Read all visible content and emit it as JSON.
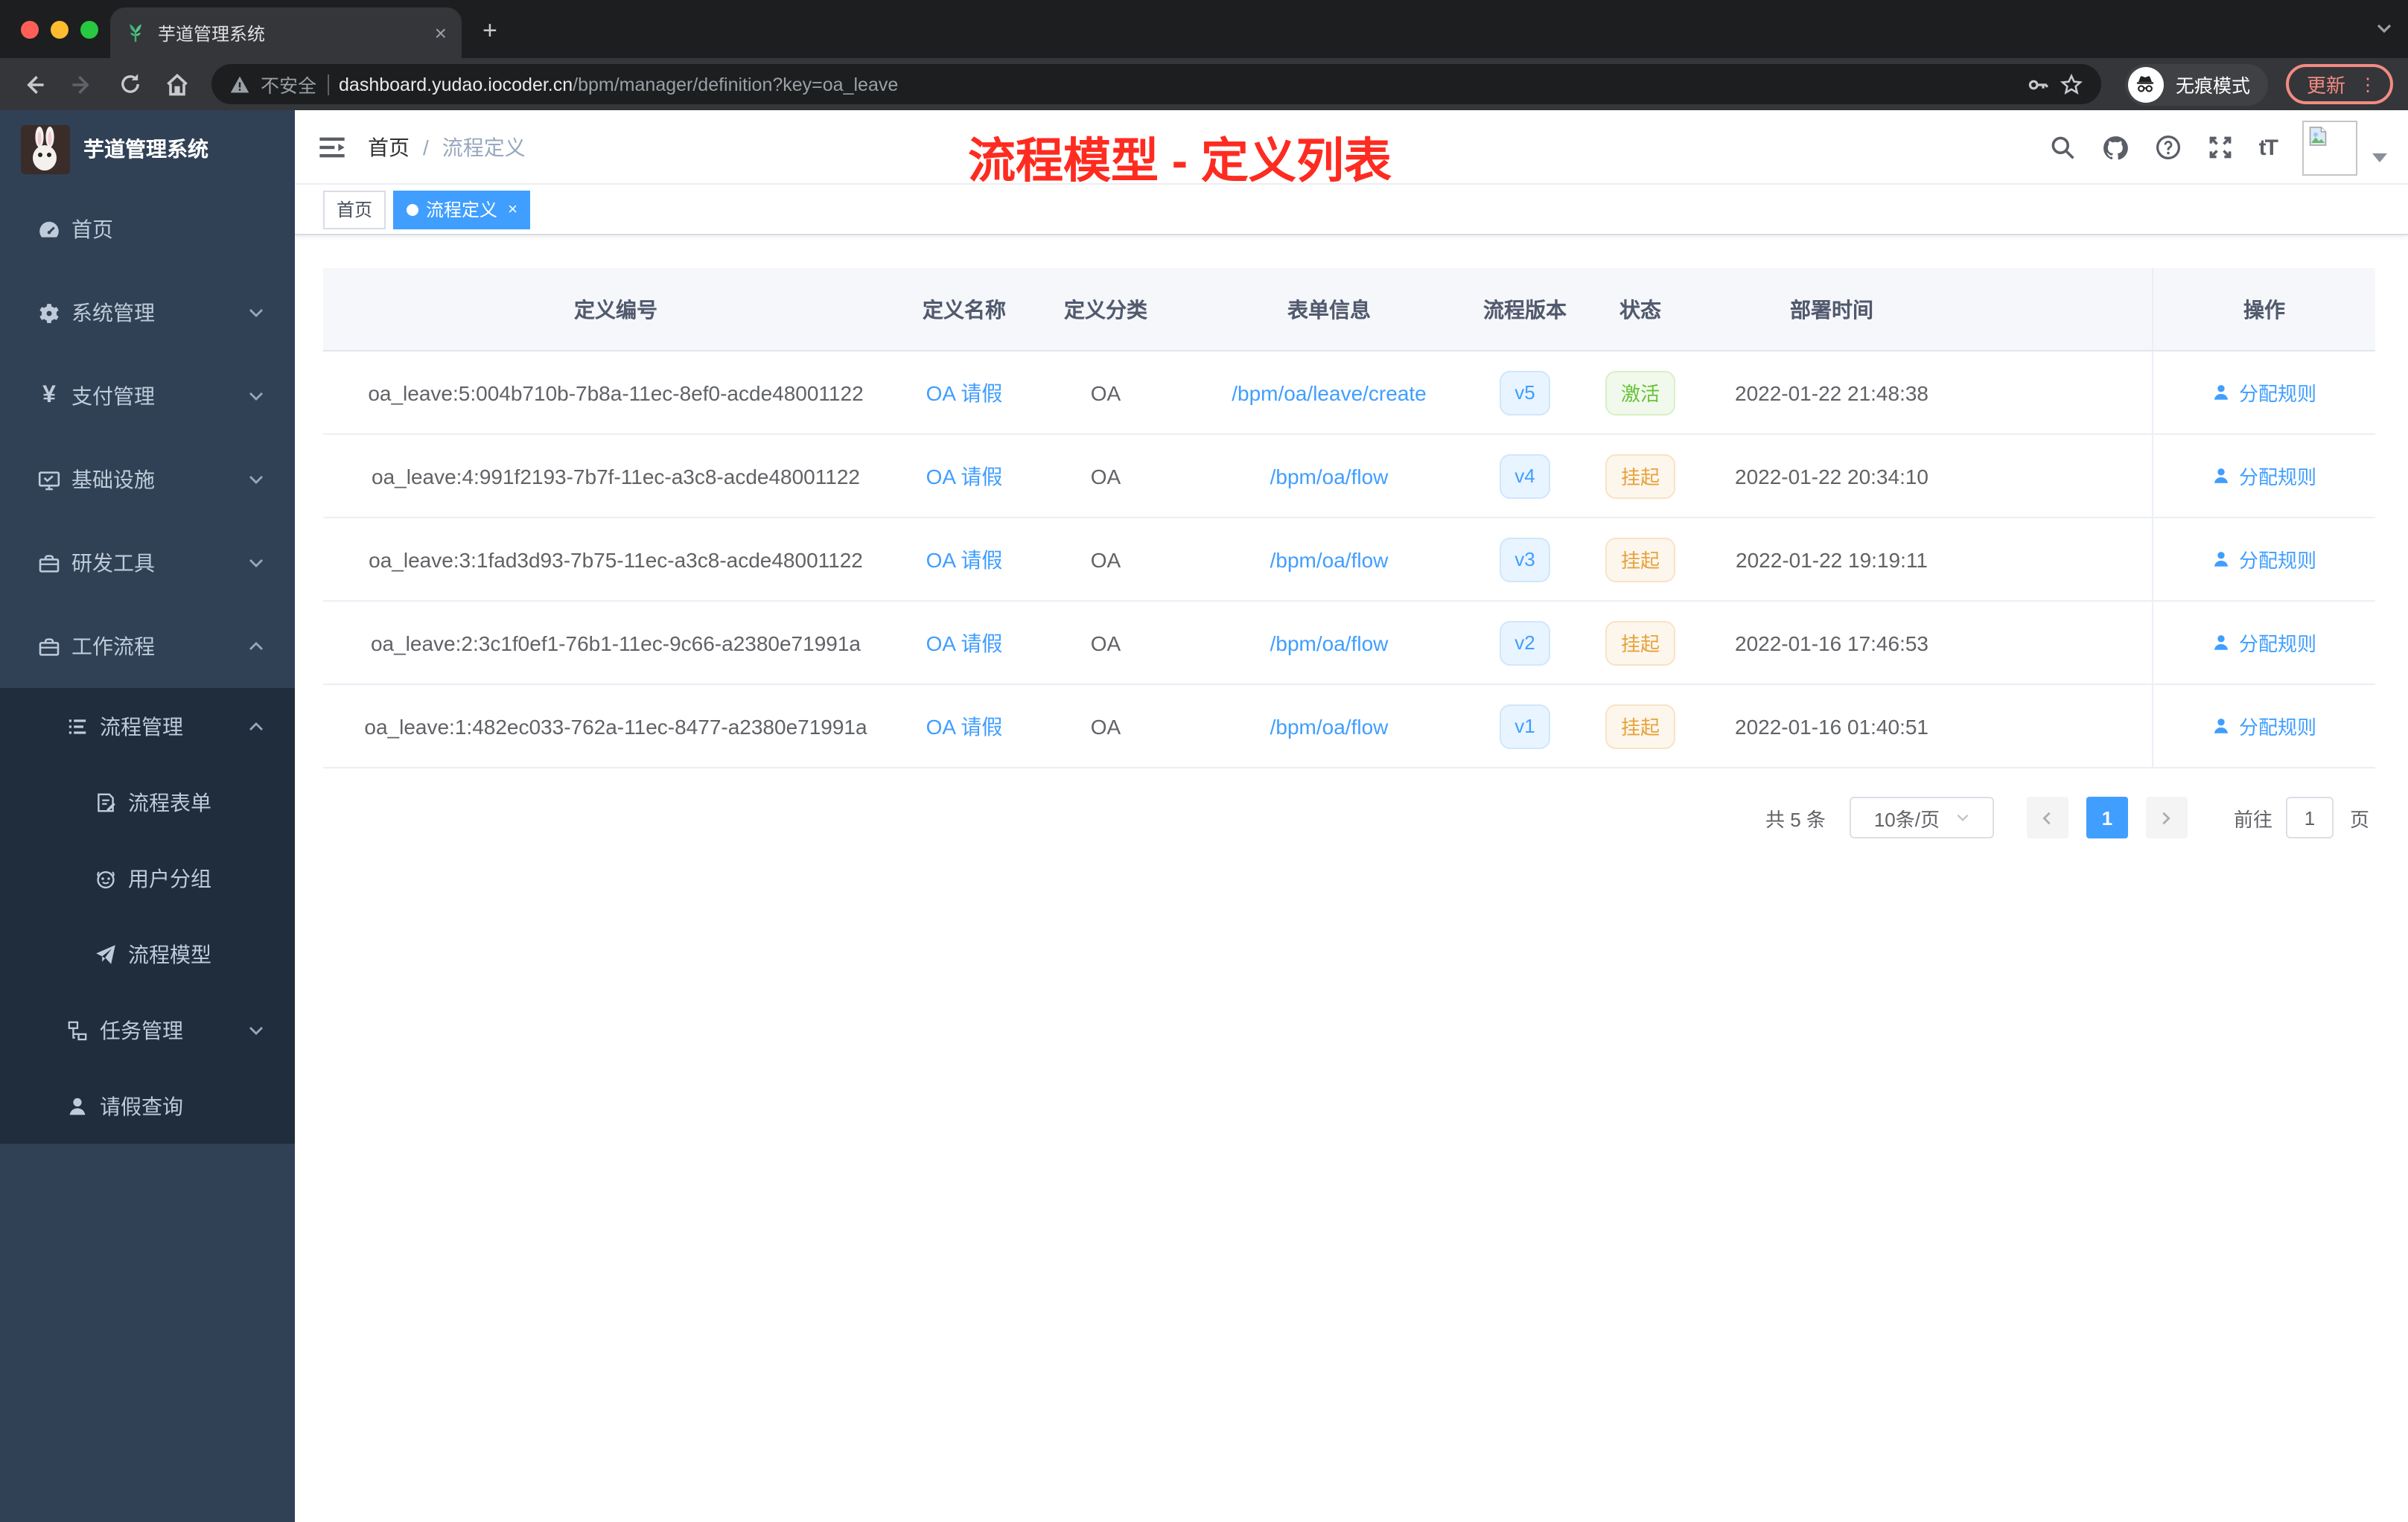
{
  "colors": {
    "accent": "#409eff",
    "annotation_red": "#fe2b20",
    "sidebar_bg": "#304156",
    "submenu_bg": "#1f2d3d",
    "status_active_green": "#67c23a",
    "status_suspended_orange": "#e6a23c"
  },
  "glyphs": {
    "close": "×",
    "plus": "+",
    "dots": "⋮",
    "caret_down": "⌄"
  },
  "browser": {
    "tab_title": "芋道管理系统",
    "security_label": "不安全",
    "url_host": "dashboard.yudao.iocoder.cn",
    "url_path": "/bpm/manager/definition?key=oa_leave",
    "incognito_label": "无痕模式",
    "update_label": "更新"
  },
  "sidebar": {
    "app_title": "芋道管理系统",
    "items": [
      {
        "icon": "gauge-icon",
        "label": "首页"
      },
      {
        "icon": "gear-icon",
        "label": "系统管理"
      },
      {
        "icon": "yen-icon",
        "label": "支付管理"
      },
      {
        "icon": "monitor-icon",
        "label": "基础设施"
      },
      {
        "icon": "toolbox-icon",
        "label": "研发工具"
      },
      {
        "icon": "briefcase-icon",
        "label": "工作流程"
      }
    ],
    "sub_items": [
      {
        "icon": "list-icon",
        "label": "流程管理"
      },
      {
        "icon": "form-edit-icon",
        "label": "流程表单"
      },
      {
        "icon": "robot-icon",
        "label": "用户分组"
      },
      {
        "icon": "paper-plane-icon",
        "label": "流程模型"
      },
      {
        "icon": "tree-icon",
        "label": "任务管理"
      },
      {
        "icon": "user-icon",
        "label": "请假查询"
      }
    ]
  },
  "header": {
    "breadcrumb_home": "首页",
    "breadcrumb_sep": "/",
    "breadcrumb_current": "流程定义",
    "annotation": "流程模型 - 定义列表"
  },
  "tags": {
    "home": "首页",
    "active": "流程定义"
  },
  "table": {
    "columns": [
      "定义编号",
      "定义名称",
      "定义分类",
      "表单信息",
      "流程版本",
      "状态",
      "部署时间",
      "操作"
    ],
    "rows": [
      {
        "id": "oa_leave:5:004b710b-7b8a-11ec-8ef0-acde48001122",
        "name": "OA 请假",
        "category": "OA",
        "form": "/bpm/oa/leave/create",
        "version": "v5",
        "status": "激活",
        "status_type": "active",
        "time": "2022-01-22 21:48:38",
        "action": "分配规则"
      },
      {
        "id": "oa_leave:4:991f2193-7b7f-11ec-a3c8-acde48001122",
        "name": "OA 请假",
        "category": "OA",
        "form": "/bpm/oa/flow",
        "version": "v4",
        "status": "挂起",
        "status_type": "suspended",
        "time": "2022-01-22 20:34:10",
        "action": "分配规则"
      },
      {
        "id": "oa_leave:3:1fad3d93-7b75-11ec-a3c8-acde48001122",
        "name": "OA 请假",
        "category": "OA",
        "form": "/bpm/oa/flow",
        "version": "v3",
        "status": "挂起",
        "status_type": "suspended",
        "time": "2022-01-22 19:19:11",
        "action": "分配规则"
      },
      {
        "id": "oa_leave:2:3c1f0ef1-76b1-11ec-9c66-a2380e71991a",
        "name": "OA 请假",
        "category": "OA",
        "form": "/bpm/oa/flow",
        "version": "v2",
        "status": "挂起",
        "status_type": "suspended",
        "time": "2022-01-16 17:46:53",
        "action": "分配规则"
      },
      {
        "id": "oa_leave:1:482ec033-762a-11ec-8477-a2380e71991a",
        "name": "OA 请假",
        "category": "OA",
        "form": "/bpm/oa/flow",
        "version": "v1",
        "status": "挂起",
        "status_type": "suspended",
        "time": "2022-01-16 01:40:51",
        "action": "分配规则"
      }
    ]
  },
  "pagination": {
    "total": "共 5 条",
    "page_size": "10条/页",
    "current_page": "1",
    "goto_label": "前往",
    "goto_value": "1",
    "page_unit": "页"
  }
}
